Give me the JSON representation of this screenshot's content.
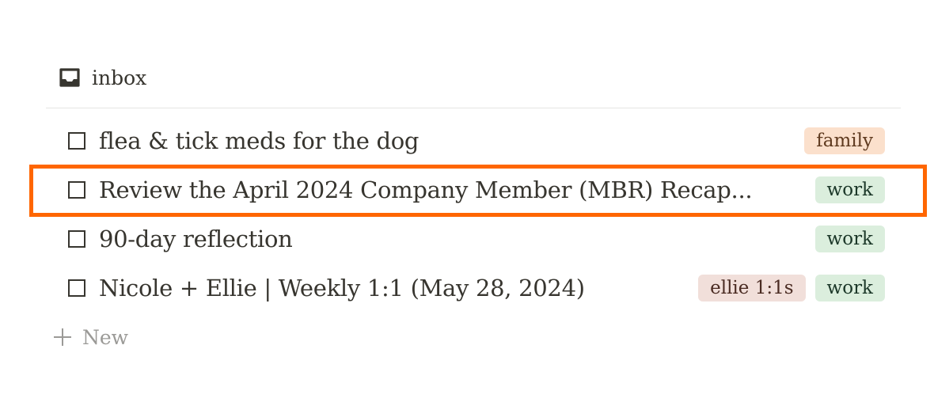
{
  "list": {
    "title": "inbox",
    "icon": "inbox-tray-icon"
  },
  "tasks": [
    {
      "title": "flea & tick meds for the dog",
      "checked": false,
      "tags": [
        {
          "label": "family",
          "bg": "#fbe0cc",
          "fg": "#5f3a1f"
        }
      ]
    },
    {
      "title": "Review the April 2024 Company Member (MBR) Recap...",
      "checked": false,
      "highlighted": true,
      "tags": [
        {
          "label": "work",
          "bg": "#dbeedd",
          "fg": "#1c3829"
        }
      ]
    },
    {
      "title": "90-day reflection",
      "checked": false,
      "tags": [
        {
          "label": "work",
          "bg": "#dbeedd",
          "fg": "#1c3829"
        }
      ]
    },
    {
      "title": "Nicole + Ellie | Weekly 1:1 (May 28, 2024)",
      "checked": false,
      "tags": [
        {
          "label": "ellie 1:1s",
          "bg": "#f1dfda",
          "fg": "#4a2b22"
        },
        {
          "label": "work",
          "bg": "#dbeedd",
          "fg": "#1c3829"
        }
      ]
    }
  ],
  "new_item": {
    "label": "New",
    "icon": "plus-icon"
  },
  "colors": {
    "highlight": "#ff6600",
    "text": "#37352f",
    "muted": "#9b9a97"
  }
}
